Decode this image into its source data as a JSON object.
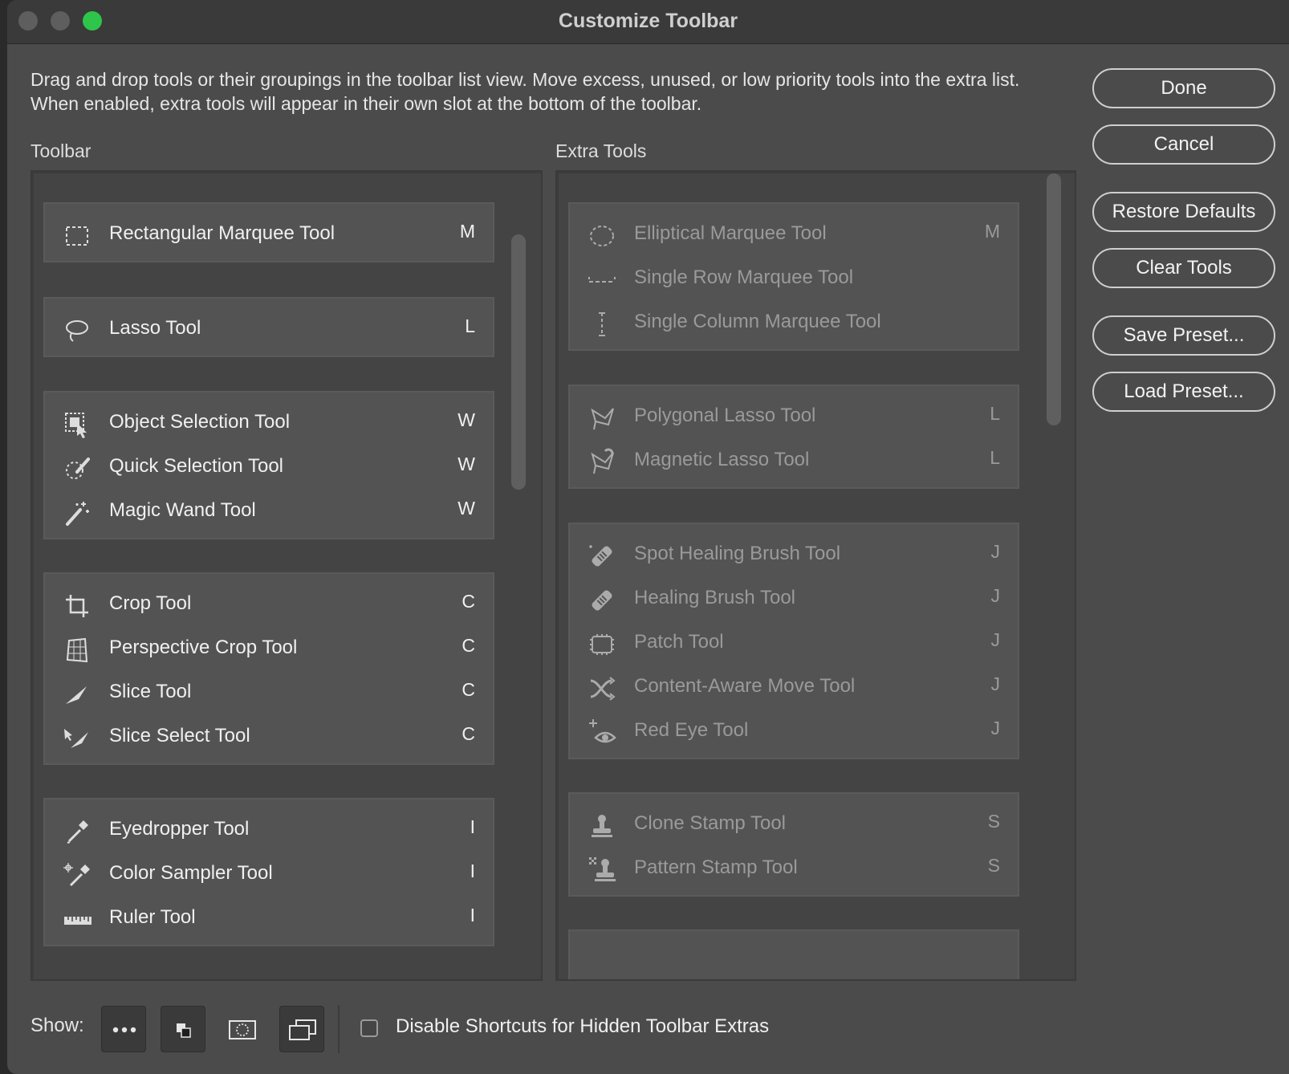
{
  "window": {
    "title": "Customize Toolbar",
    "description": "Drag and drop tools or their groupings in the toolbar list view. Move excess, unused, or low priority tools into the extra list. When enabled, extra tools will appear in their own slot at the bottom of the toolbar."
  },
  "columns": {
    "toolbar_label": "Toolbar",
    "extra_label": "Extra Tools"
  },
  "toolbar_groups": [
    {
      "tools": [
        {
          "icon": "rect-marquee-icon",
          "name": "Rectangular Marquee Tool",
          "key": "M"
        }
      ]
    },
    {
      "tools": [
        {
          "icon": "lasso-icon",
          "name": "Lasso Tool",
          "key": "L"
        }
      ]
    },
    {
      "tools": [
        {
          "icon": "object-selection-icon",
          "name": "Object Selection Tool",
          "key": "W"
        },
        {
          "icon": "quick-selection-icon",
          "name": "Quick Selection Tool",
          "key": "W"
        },
        {
          "icon": "magic-wand-icon",
          "name": "Magic Wand Tool",
          "key": "W"
        }
      ]
    },
    {
      "tools": [
        {
          "icon": "crop-icon",
          "name": "Crop Tool",
          "key": "C"
        },
        {
          "icon": "perspective-crop-icon",
          "name": "Perspective Crop Tool",
          "key": "C"
        },
        {
          "icon": "slice-icon",
          "name": "Slice Tool",
          "key": "C"
        },
        {
          "icon": "slice-select-icon",
          "name": "Slice Select Tool",
          "key": "C"
        }
      ]
    },
    {
      "tools": [
        {
          "icon": "eyedropper-icon",
          "name": "Eyedropper Tool",
          "key": "I"
        },
        {
          "icon": "color-sampler-icon",
          "name": "Color Sampler Tool",
          "key": "I"
        },
        {
          "icon": "ruler-icon",
          "name": "Ruler Tool",
          "key": "I"
        }
      ]
    }
  ],
  "extra_groups": [
    {
      "tools": [
        {
          "icon": "elliptical-marquee-icon",
          "name": "Elliptical Marquee Tool",
          "key": "M"
        },
        {
          "icon": "single-row-marquee-icon",
          "name": "Single Row Marquee Tool",
          "key": ""
        },
        {
          "icon": "single-column-marquee-icon",
          "name": "Single Column Marquee Tool",
          "key": ""
        }
      ]
    },
    {
      "tools": [
        {
          "icon": "polygonal-lasso-icon",
          "name": "Polygonal Lasso Tool",
          "key": "L"
        },
        {
          "icon": "magnetic-lasso-icon",
          "name": "Magnetic Lasso Tool",
          "key": "L"
        }
      ]
    },
    {
      "tools": [
        {
          "icon": "spot-healing-icon",
          "name": "Spot Healing Brush Tool",
          "key": "J"
        },
        {
          "icon": "healing-brush-icon",
          "name": "Healing Brush Tool",
          "key": "J"
        },
        {
          "icon": "patch-icon",
          "name": "Patch Tool",
          "key": "J"
        },
        {
          "icon": "content-aware-move-icon",
          "name": "Content-Aware Move Tool",
          "key": "J"
        },
        {
          "icon": "red-eye-icon",
          "name": "Red Eye Tool",
          "key": "J"
        }
      ]
    },
    {
      "tools": [
        {
          "icon": "clone-stamp-icon",
          "name": "Clone Stamp Tool",
          "key": "S"
        },
        {
          "icon": "pattern-stamp-icon",
          "name": "Pattern Stamp Tool",
          "key": "S"
        }
      ]
    }
  ],
  "buttons": {
    "done": "Done",
    "cancel": "Cancel",
    "restore": "Restore Defaults",
    "clear": "Clear Tools",
    "save": "Save Preset...",
    "load": "Load Preset..."
  },
  "bottom": {
    "show_label": "Show:",
    "show_buttons": [
      "more-icon",
      "swap-colors-icon",
      "quick-mask-icon",
      "screen-mode-icon"
    ],
    "checkbox_label": "Disable Shortcuts for Hidden Toolbar Extras",
    "checkbox_checked": false
  }
}
